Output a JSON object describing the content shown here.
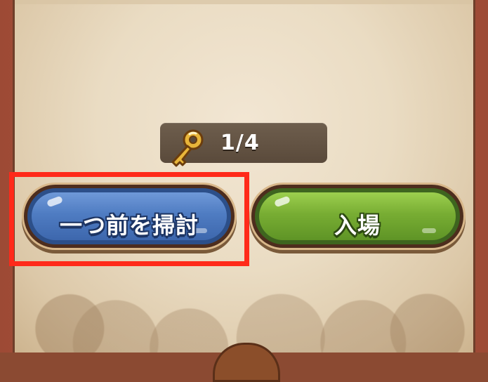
{
  "key_counter": {
    "icon": "key-icon",
    "value": "1/4"
  },
  "buttons": {
    "sweep_previous": "一つ前を掃討",
    "enter": "入場"
  },
  "colors": {
    "frame": "#9d4a35",
    "panel_bg": "#eadcc3",
    "counter_bg": "#5a4a3b",
    "blue_button": "#4f7cc2",
    "green_button": "#78ad33",
    "highlight": "#ff2a1a",
    "key": "#e8b53a"
  }
}
